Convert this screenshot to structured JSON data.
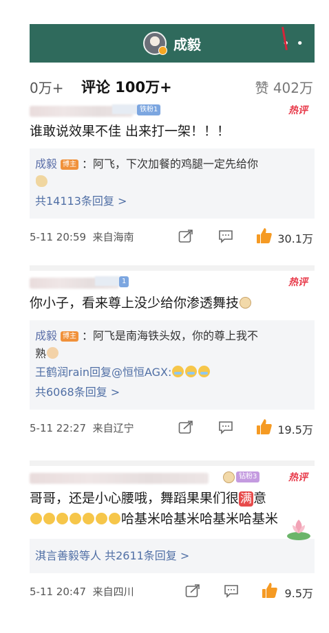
{
  "header": {
    "title": "成毅",
    "more": "• •"
  },
  "tabs": {
    "repost": "0万+",
    "comments": "评论 100万+",
    "likes": "赞 402万"
  },
  "comments": [
    {
      "fan_badge": "铁粉1",
      "hot_label": "热评",
      "text": "谁敢说效果不佳 出来打一架！！！",
      "reply": {
        "author": "成毅",
        "badge": "博主",
        "text_line1": "：阿飞，下次加餐的鸡腿一定先给你",
        "text_line2": "",
        "count": "共14113条回复 >"
      },
      "time": "5-11 20:59",
      "location": "来自海南",
      "likes": "30.1万"
    },
    {
      "fan_badge": "1",
      "hot_label": "热评",
      "text": "你小子，看来尊上没少给你渗透舞技",
      "reply": {
        "author": "成毅",
        "badge": "博主",
        "text_line1": "：阿飞是南海铁头奴，你的尊上我不",
        "text_line2": "熟",
        "sub_reply": "王鹤润rain回复@恒恒AGX:",
        "count": "共6068条回复 >"
      },
      "time": "5-11 22:27",
      "location": "来自辽宁",
      "likes": "19.5万"
    },
    {
      "fan_badge": "钻粉3",
      "hot_label": "热评",
      "text_a": "哥哥，还是小心腰哦，舞蹈果果们很",
      "text_red": "满",
      "text_b": "意",
      "text_line2": "哈基米哈基米哈基米哈基米",
      "reply": {
        "count": "淇言善毅等人  共2611条回复 >"
      },
      "time": "5-11 20:47",
      "location": "来自四川",
      "likes": "9.5万"
    }
  ],
  "icons": {
    "share": "share-icon",
    "comment": "comment-icon",
    "like": "thumbs-up-icon"
  },
  "colors": {
    "header_bg": "#2f6a5c",
    "hot": "#e83a4a",
    "link": "#506fa5"
  }
}
